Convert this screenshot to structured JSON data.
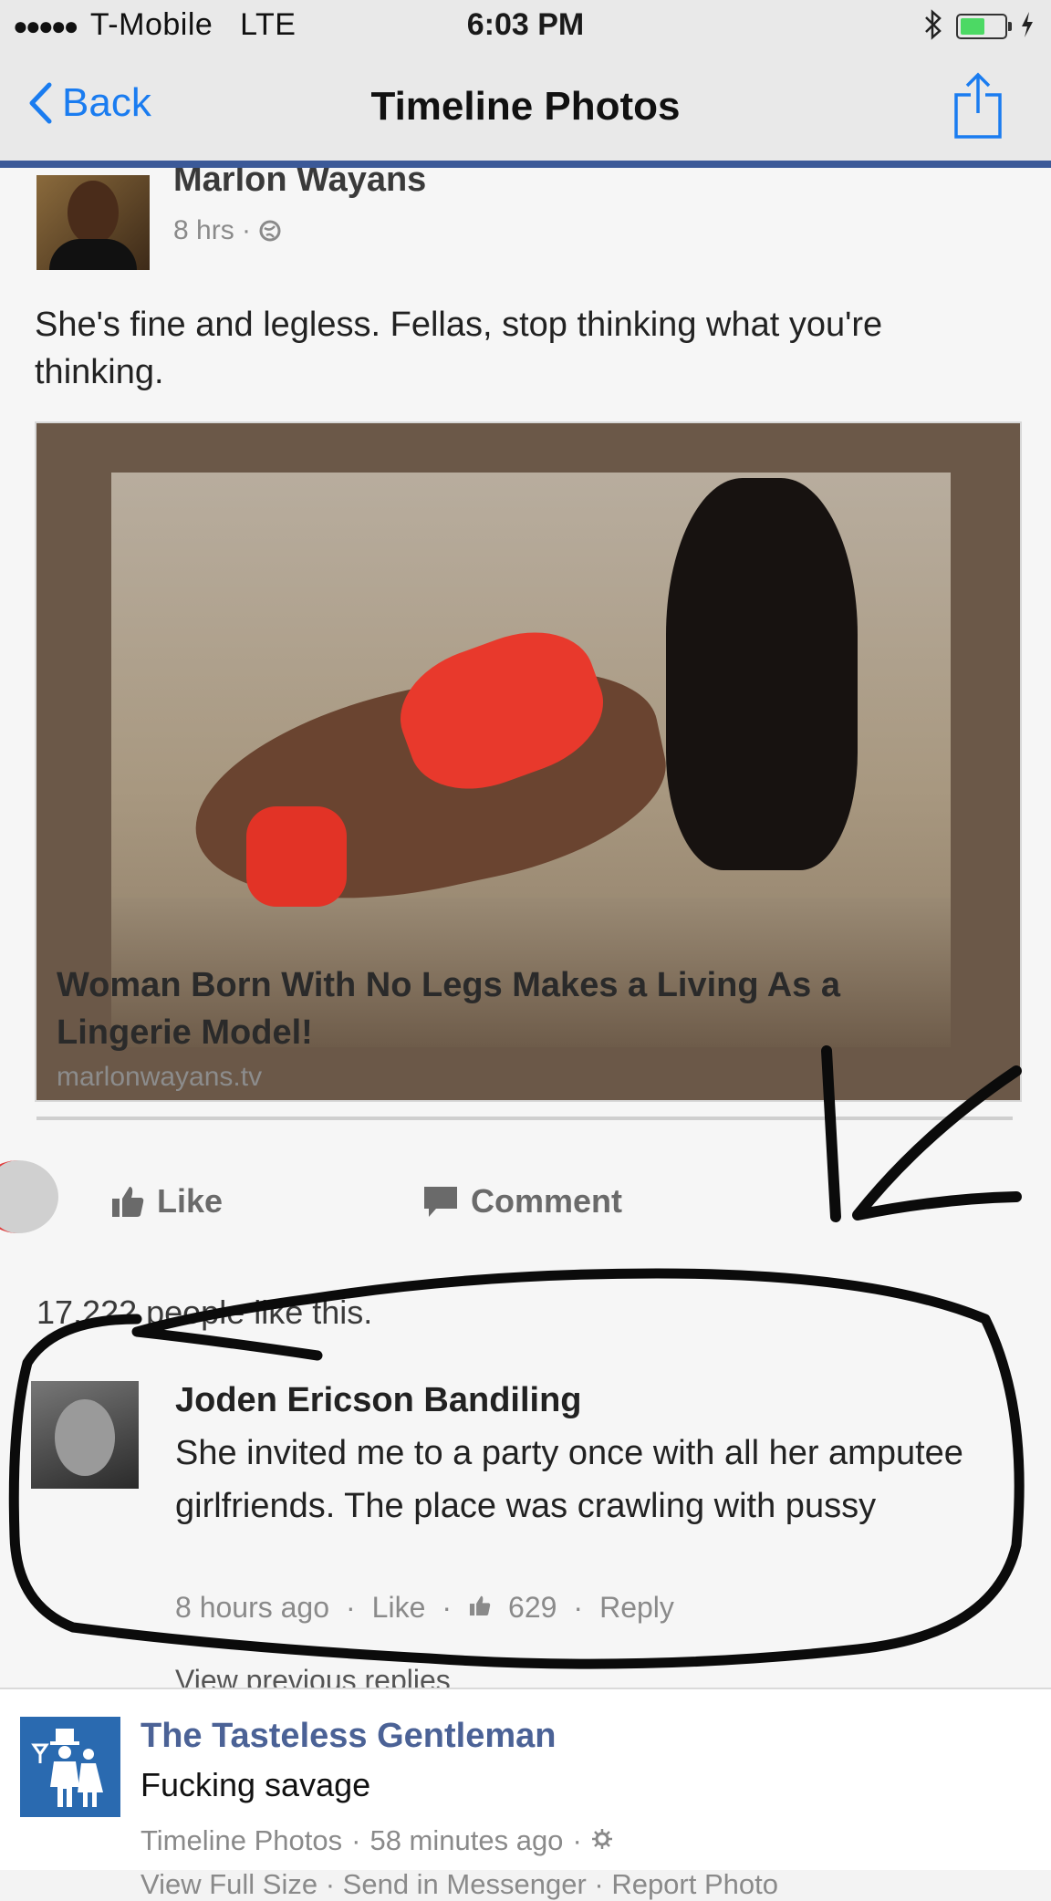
{
  "status_bar": {
    "carrier": "T-Mobile",
    "network": "LTE",
    "time": "6:03 PM",
    "battery_level": 0.6
  },
  "nav": {
    "back_label": "Back",
    "title": "Timeline Photos"
  },
  "post": {
    "author": "Marlon Wayans",
    "time": "8 hrs",
    "text": "She's fine and legless. Fellas, stop thinking what you're thinking.",
    "link_title": "Woman Born With No Legs Makes a Living As a Lingerie Model!",
    "link_domain": "marlonwayans.tv",
    "actions": {
      "like": "Like",
      "comment": "Comment"
    },
    "likes_summary": "17,222 people like this."
  },
  "comment": {
    "author": "Joden Ericson Bandiling",
    "text": "She invited me to a party once with all her amputee girlfriends. The place was crawling with pussy",
    "time": "8 hours ago",
    "like": "Like",
    "like_count": "629",
    "reply": "Reply",
    "more_replies": "View previous replies"
  },
  "caption": {
    "page_name": "The Tasteless Gentleman",
    "text": "Fucking savage",
    "album": "Timeline Photos",
    "time": "58 minutes ago",
    "separator": "·",
    "next_line": "View Full Size · Send in Messenger · Report Photo"
  },
  "colors": {
    "ios_blue": "#1a7cf0",
    "facebook_blue": "#3b5998",
    "page_name": "#4b6296"
  }
}
